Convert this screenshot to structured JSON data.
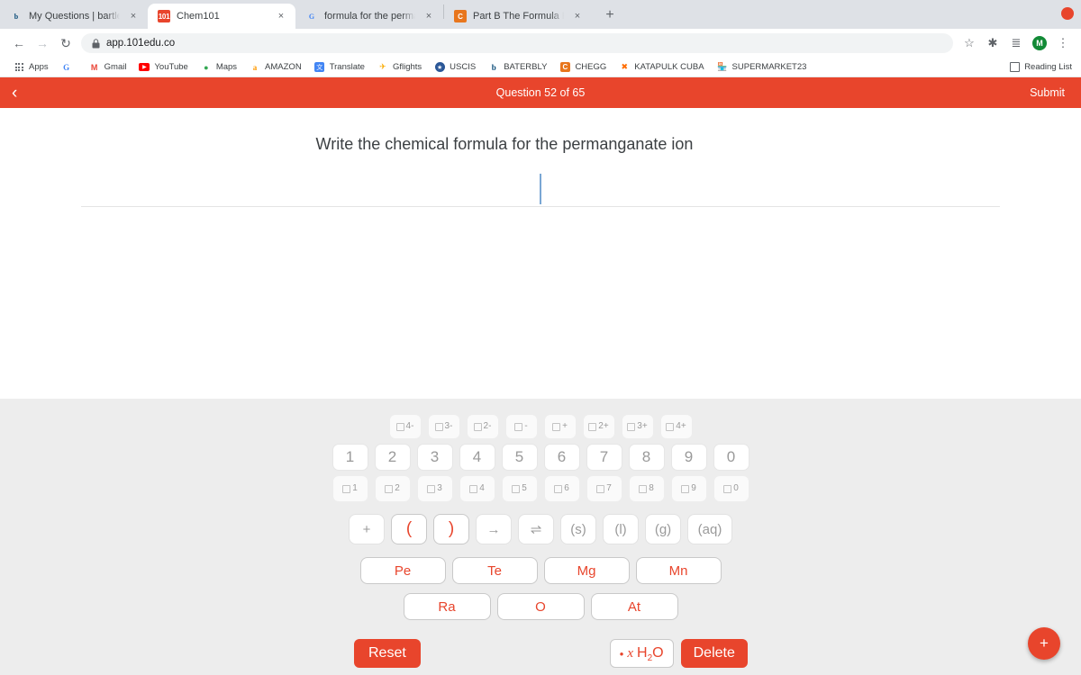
{
  "browser": {
    "tabs": [
      {
        "title": "My Questions | bartleby",
        "favicon": "bartleby-b-icon",
        "active": false
      },
      {
        "title": "Chem101",
        "favicon": "chem101-icon",
        "active": true
      },
      {
        "title": "formula for the permanganate i",
        "favicon": "google-g-icon",
        "active": false
      },
      {
        "title": "Part B The Formula For The Ox",
        "favicon": "chegg-c-icon",
        "active": false
      }
    ],
    "new_tab_label": "+",
    "tab_close_label": "×",
    "nav": {
      "back": "←",
      "forward": "→",
      "reload": "↻",
      "lock": "🔒",
      "url": "app.101edu.co"
    },
    "toolbar_icons": {
      "bookmark_star": "☆",
      "extensions": "✱",
      "reading_list_btn": "≣",
      "avatar_initial": "M",
      "menu": "⋮"
    },
    "bookmarks": [
      {
        "label": "Apps",
        "icon": "apps-grid-icon"
      },
      {
        "label": "",
        "icon": "google-g-icon"
      },
      {
        "label": "Gmail",
        "icon": "gmail-icon"
      },
      {
        "label": "YouTube",
        "icon": "youtube-icon"
      },
      {
        "label": "Maps",
        "icon": "maps-pin-icon"
      },
      {
        "label": "AMAZON",
        "icon": "amazon-a-icon"
      },
      {
        "label": "Translate",
        "icon": "translate-icon"
      },
      {
        "label": "Gflights",
        "icon": "gflights-icon"
      },
      {
        "label": "USCIS",
        "icon": "uscis-icon"
      },
      {
        "label": "BATERBLY",
        "icon": "bartleby-b-icon"
      },
      {
        "label": "CHEGG",
        "icon": "chegg-c-icon"
      },
      {
        "label": "KATAPULK CUBA",
        "icon": "katapulk-icon"
      },
      {
        "label": "SUPERMARKET23",
        "icon": "supermarket23-icon"
      }
    ],
    "reading_list_label": "Reading List"
  },
  "app": {
    "header": {
      "back_icon": "‹",
      "question_counter": "Question 52 of 65",
      "submit_label": "Submit"
    },
    "question": {
      "prompt": "Write the chemical formula for the permanganate ion",
      "answer_value": "",
      "caret_visible": true
    },
    "colors": {
      "accent": "#e8452c",
      "keypad_bg": "#ededed",
      "key_face": "#fafafa",
      "key_text_muted": "#9a9a9a",
      "caret": "#7aa7d4"
    }
  },
  "keypad": {
    "charge_row": [
      {
        "name": "charge-4-minus",
        "sup": "4-"
      },
      {
        "name": "charge-3-minus",
        "sup": "3-"
      },
      {
        "name": "charge-2-minus",
        "sup": "2-"
      },
      {
        "name": "charge-1-minus",
        "sup": "-"
      },
      {
        "name": "charge-1-plus",
        "sup": "+"
      },
      {
        "name": "charge-2-plus",
        "sup": "2+"
      },
      {
        "name": "charge-3-plus",
        "sup": "3+"
      },
      {
        "name": "charge-4-plus",
        "sup": "4+"
      }
    ],
    "number_row": [
      "1",
      "2",
      "3",
      "4",
      "5",
      "6",
      "7",
      "8",
      "9",
      "0"
    ],
    "subscript_row": [
      {
        "name": "subscript-1",
        "sub": "1"
      },
      {
        "name": "subscript-2",
        "sub": "2"
      },
      {
        "name": "subscript-3",
        "sub": "3"
      },
      {
        "name": "subscript-4",
        "sub": "4"
      },
      {
        "name": "subscript-5",
        "sub": "5"
      },
      {
        "name": "subscript-6",
        "sub": "6"
      },
      {
        "name": "subscript-7",
        "sub": "7"
      },
      {
        "name": "subscript-8",
        "sub": "8"
      },
      {
        "name": "subscript-9",
        "sub": "9"
      },
      {
        "name": "subscript-0",
        "sub": "0"
      }
    ],
    "operator_row": [
      {
        "name": "plus-key",
        "label": "+",
        "style": "plain"
      },
      {
        "name": "open-paren-key",
        "label": "(",
        "style": "paren"
      },
      {
        "name": "close-paren-key",
        "label": ")",
        "style": "paren"
      },
      {
        "name": "yields-arrow-key",
        "label": "→",
        "style": "plain"
      },
      {
        "name": "equilibrium-arrow-key",
        "label": "⇌",
        "style": "plain"
      },
      {
        "name": "state-solid-key",
        "label": "(s)",
        "style": "plain"
      },
      {
        "name": "state-liquid-key",
        "label": "(l)",
        "style": "plain"
      },
      {
        "name": "state-gas-key",
        "label": "(g)",
        "style": "plain"
      },
      {
        "name": "state-aqueous-key",
        "label": "(aq)",
        "style": "wide"
      }
    ],
    "element_row_1": [
      "Pe",
      "Te",
      "Mg",
      "Mn"
    ],
    "element_row_2": [
      "Ra",
      "O",
      "At"
    ]
  },
  "bottom": {
    "reset_label": "Reset",
    "hydrate": {
      "dot": "•",
      "variable": "x",
      "formula_h": "H",
      "formula_sub": "2",
      "formula_o": "O"
    },
    "delete_label": "Delete",
    "fab_label": "+"
  }
}
